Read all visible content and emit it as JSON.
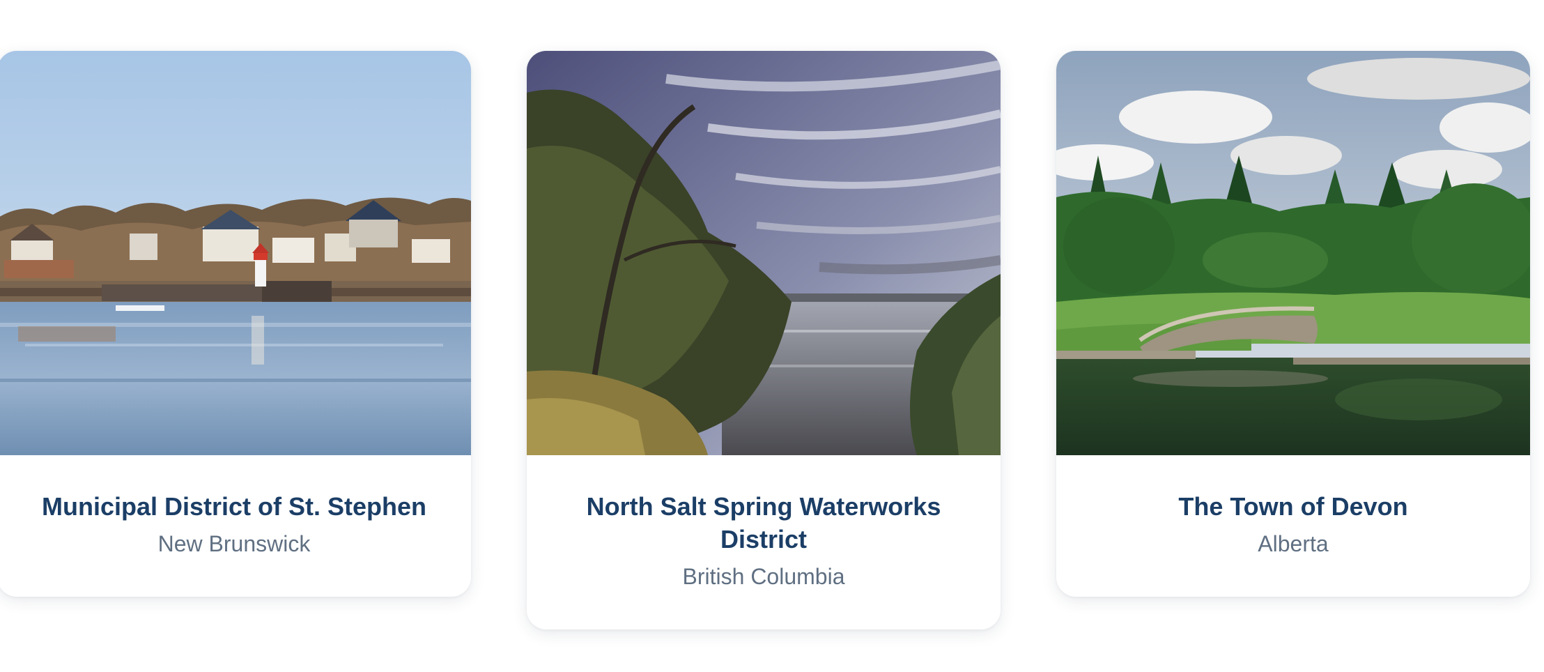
{
  "cards": [
    {
      "title": "Municipal District of St. Stephen",
      "subtitle": "New Brunswick",
      "image_icon": "harbour-lighthouse-photo"
    },
    {
      "title": "North Salt Spring Waterworks District",
      "subtitle": "British Columbia",
      "image_icon": "lake-trees-photo"
    },
    {
      "title": "The Town of Devon",
      "subtitle": "Alberta",
      "image_icon": "park-bridge-pond-photo"
    }
  ],
  "colors": {
    "title": "#1b3e66",
    "subtitle": "#5f6f82",
    "card_background": "#ffffff"
  }
}
